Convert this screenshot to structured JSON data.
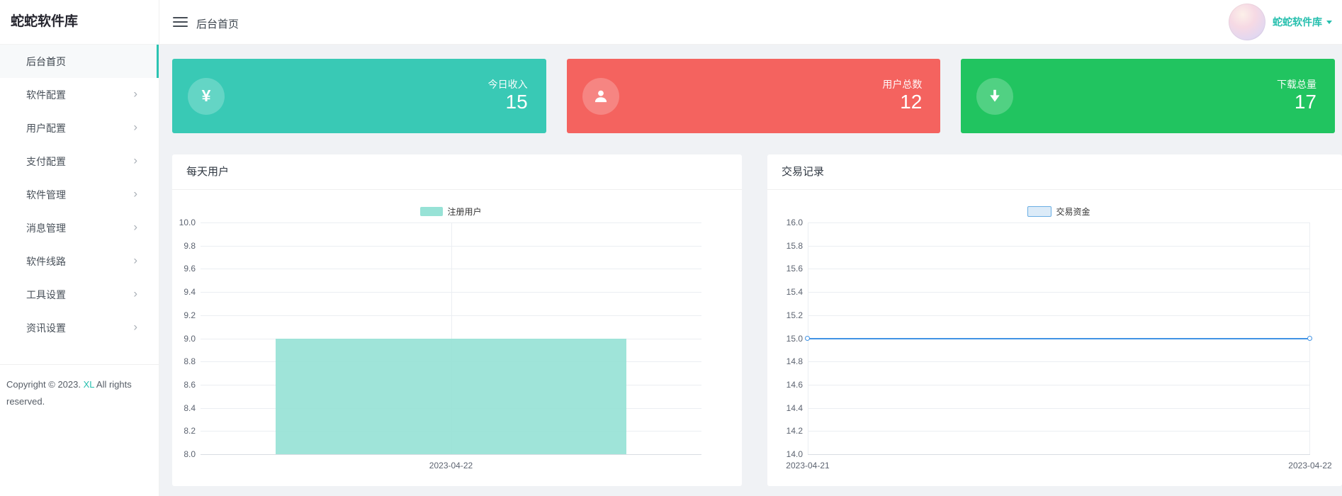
{
  "app": {
    "accent": "#26bfae"
  },
  "sidebar": {
    "title": "蛇蛇软件库",
    "items": [
      {
        "key": "dashboard",
        "label": "后台首页",
        "active": true,
        "has_children": false
      },
      {
        "key": "software-config",
        "label": "软件配置",
        "active": false,
        "has_children": true
      },
      {
        "key": "user-config",
        "label": "用户配置",
        "active": false,
        "has_children": true
      },
      {
        "key": "payment-config",
        "label": "支付配置",
        "active": false,
        "has_children": true
      },
      {
        "key": "software-manage",
        "label": "软件管理",
        "active": false,
        "has_children": true
      },
      {
        "key": "message-manage",
        "label": "消息管理",
        "active": false,
        "has_children": true
      },
      {
        "key": "software-line",
        "label": "软件线路",
        "active": false,
        "has_children": true
      },
      {
        "key": "tool-settings",
        "label": "工具设置",
        "active": false,
        "has_children": true
      },
      {
        "key": "news-settings",
        "label": "资讯设置",
        "active": false,
        "has_children": true
      }
    ],
    "copyright": {
      "prefix": "Copyright © 2023. ",
      "link": "XL",
      "suffix": " All rights reserved."
    }
  },
  "header": {
    "breadcrumb": "后台首页",
    "user_name": "蛇蛇软件库"
  },
  "stat_cards": [
    {
      "label": "今日收入",
      "value": "15",
      "color": "#39c9b5",
      "icon": "yen-icon",
      "glyph": "¥"
    },
    {
      "label": "用户总数",
      "value": "12",
      "color": "#f4635f",
      "icon": "user-icon"
    },
    {
      "label": "下载总量",
      "value": "17",
      "color": "#21c460",
      "icon": "download-icon"
    }
  ],
  "chart_data": [
    {
      "type": "bar",
      "title": "每天用户",
      "legend": [
        "注册用户"
      ],
      "categories": [
        "2023-04-22"
      ],
      "series": [
        {
          "name": "注册用户",
          "values": [
            9
          ]
        }
      ],
      "ylim": [
        8,
        10
      ],
      "ytick_step": 0.2,
      "bar_color": "#97e2d6",
      "grid": true,
      "legend_position": "top-center"
    },
    {
      "type": "line",
      "title": "交易记录",
      "legend": [
        "交易资金"
      ],
      "categories": [
        "2023-04-21",
        "2023-04-22"
      ],
      "series": [
        {
          "name": "交易资金",
          "values": [
            15,
            15
          ]
        }
      ],
      "ylim": [
        14,
        16
      ],
      "ytick_step": 0.2,
      "line_color": "#4193e4",
      "marker_fill": "#ffffff",
      "swatch_fill": "#dcebf8",
      "swatch_border": "#6aaee4",
      "grid": true,
      "legend_position": "top-center"
    }
  ]
}
